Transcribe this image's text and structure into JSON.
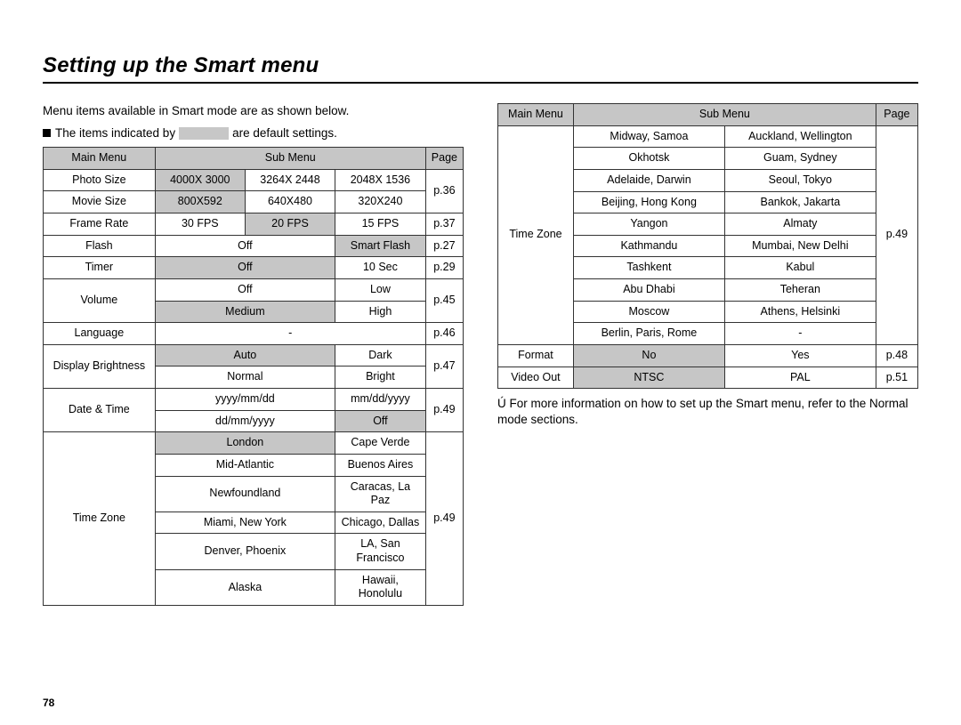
{
  "title": "Setting up the Smart menu",
  "intro": "Menu items available in Smart mode are as shown below.",
  "legend_pre": "The items indicated by",
  "legend_post": "are default settings.",
  "footnote_pre": "Ú",
  "footnote": "For more information on how to set up the Smart menu, refer to the Normal mode sections.",
  "page_num": "78",
  "head": {
    "main": "Main Menu",
    "sub": "Sub Menu",
    "page": "Page"
  },
  "left": {
    "photo_size": {
      "main": "Photo Size",
      "s1": "4000X 3000",
      "s2": "3264X 2448",
      "s3": "2048X 1536",
      "page": "p.36"
    },
    "movie_size": {
      "main": "Movie Size",
      "s1": "800X592",
      "s2": "640X480",
      "s3": "320X240",
      "page": ""
    },
    "frame_rate": {
      "main": "Frame Rate",
      "s1": "30 FPS",
      "s2": "20 FPS",
      "s3": "15 FPS",
      "page": "p.37"
    },
    "flash": {
      "main": "Flash",
      "s1": "Off",
      "s2": "Smart Flash",
      "page": "p.27"
    },
    "timer": {
      "main": "Timer",
      "s1": "Off",
      "s2": "10 Sec",
      "page": "p.29"
    },
    "volume": {
      "main": "Volume",
      "s1": "Off",
      "s2": "Low",
      "s3": "Medium",
      "s4": "High",
      "page": "p.45"
    },
    "language": {
      "main": "Language",
      "s1": "-",
      "page": "p.46"
    },
    "disp_bright": {
      "main": "Display  Brightness",
      "s1": "Auto",
      "s2": "Dark",
      "s3": "Normal",
      "s4": "Bright",
      "page": "p.47"
    },
    "date_time": {
      "main": "Date & Time",
      "s1": "yyyy/mm/dd",
      "s2": "mm/dd/yyyy",
      "s3": "dd/mm/yyyy",
      "s4": "Off",
      "page": "p.49"
    },
    "tz": {
      "main": "Time Zone",
      "r1a": "London",
      "r1b": "Cape Verde",
      "r2a": "Mid-Atlantic",
      "r2b": "Buenos Aires",
      "r3a": "Newfoundland",
      "r3b": "Caracas, La Paz",
      "r4a": "Miami, New York",
      "r4b": "Chicago, Dallas",
      "r5a": "Denver, Phoenix",
      "r5b": "LA, San Francisco",
      "r6a": "Alaska",
      "r6b": "Hawaii, Honolulu",
      "page": "p.49"
    }
  },
  "right": {
    "tz": {
      "main": "Time Zone",
      "r1a": "Midway, Samoa",
      "r1b": "Auckland, Wellington",
      "r2a": "Okhotsk",
      "r2b": "Guam, Sydney",
      "r3a": "Adelaide, Darwin",
      "r3b": "Seoul, Tokyo",
      "r4a": "Beijing, Hong Kong",
      "r4b": "Bankok, Jakarta",
      "r5a": "Yangon",
      "r5b": "Almaty",
      "r6a": "Kathmandu",
      "r6b": "Mumbai, New Delhi",
      "r7a": "Tashkent",
      "r7b": "Kabul",
      "r8a": "Abu Dhabi",
      "r8b": "Teheran",
      "r9a": "Moscow",
      "r9b": "Athens, Helsinki",
      "r10a": "Berlin, Paris, Rome",
      "r10b": "-",
      "page": "p.49"
    },
    "format": {
      "main": "Format",
      "s1": "No",
      "s2": "Yes",
      "page": "p.48"
    },
    "video_out": {
      "main": "Video Out",
      "s1": "NTSC",
      "s2": "PAL",
      "page": "p.51"
    }
  }
}
